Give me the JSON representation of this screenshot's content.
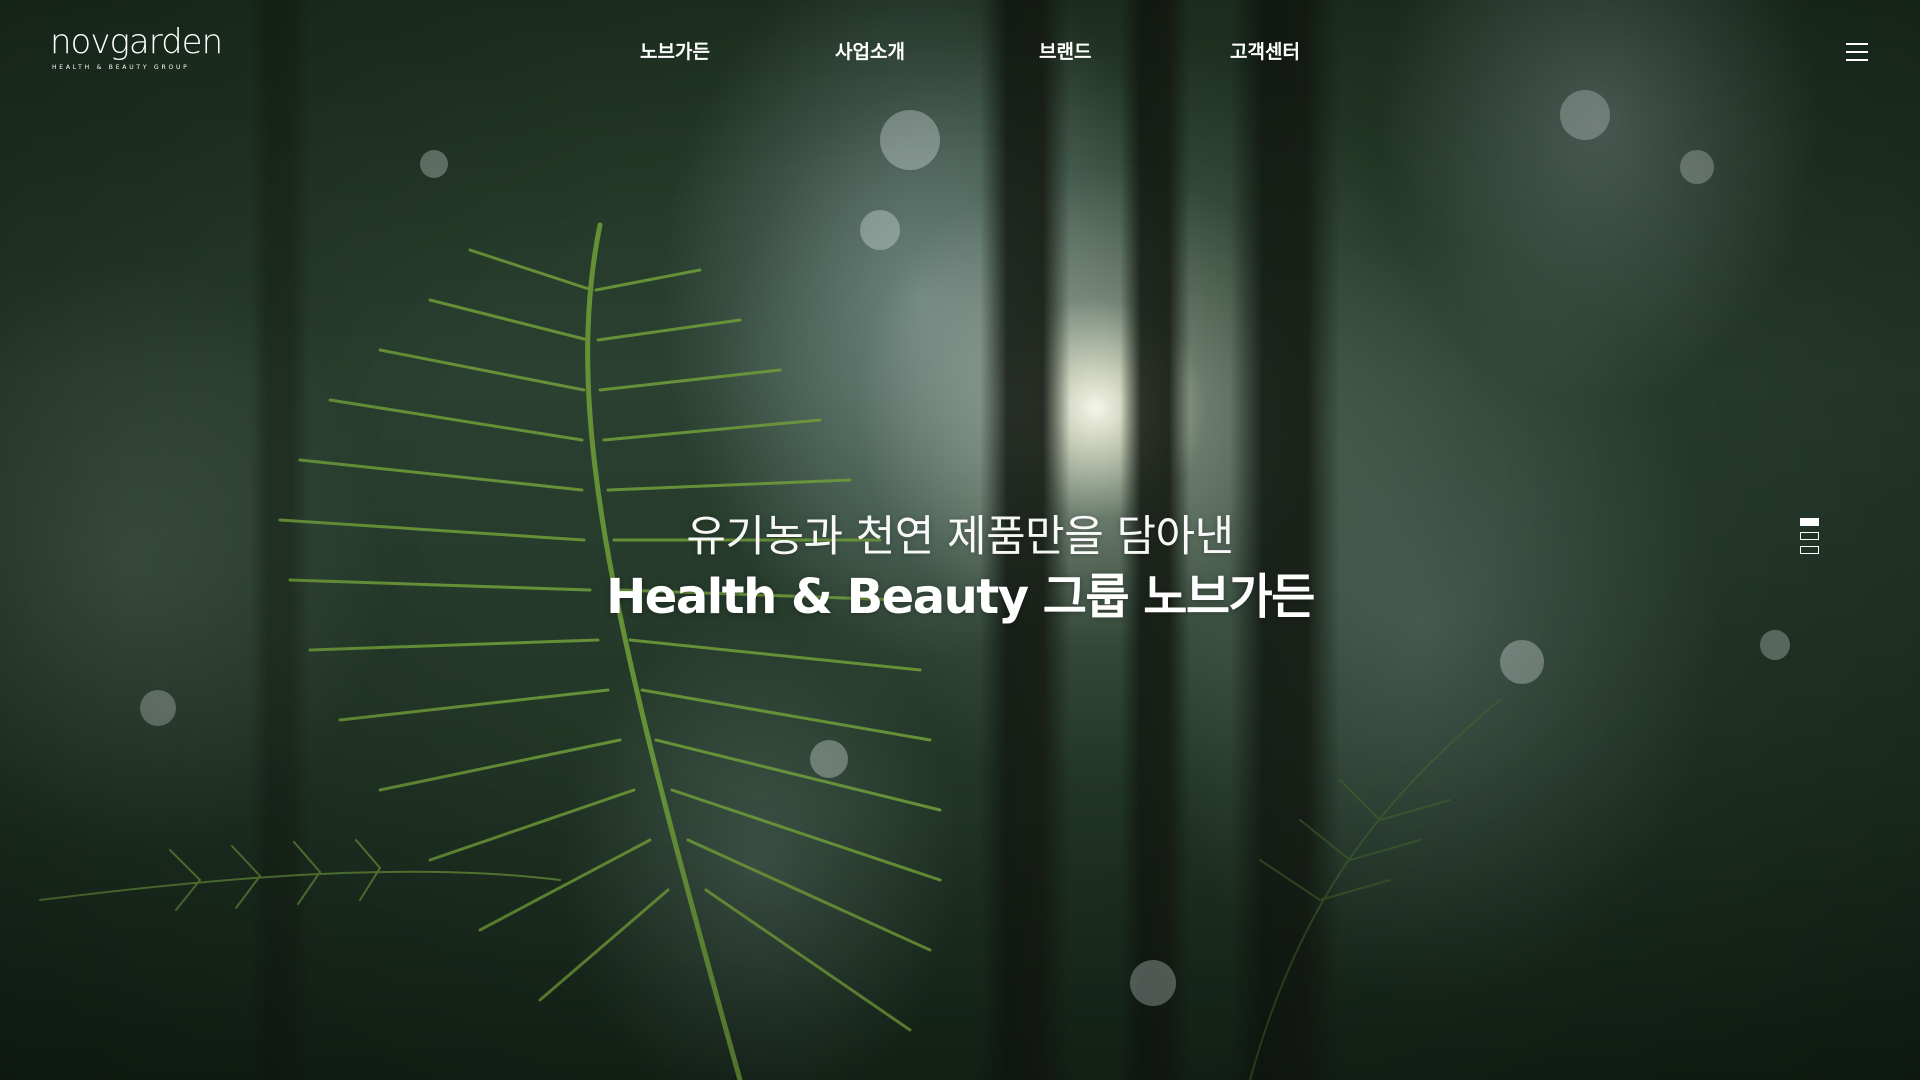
{
  "header": {
    "logo": {
      "wordmark": "novgarden",
      "tagline": "HEALTH & BEAUTY GROUP"
    },
    "nav": [
      {
        "label": "노브가든"
      },
      {
        "label": "사업소개"
      },
      {
        "label": "브랜드"
      },
      {
        "label": "고객센터"
      }
    ],
    "menu_icon": "hamburger-icon"
  },
  "hero": {
    "line1": "유기농과 천연 제품만을 담아낸",
    "line2": "Health & Beauty 그룹 노브가든",
    "background": "forest-fern-sunlight-photo"
  },
  "pager": {
    "total": 3,
    "active_index": 1
  },
  "colors": {
    "text": "#ffffff",
    "background_dark": "#1f3323",
    "fern_green": "#5a8a32"
  }
}
